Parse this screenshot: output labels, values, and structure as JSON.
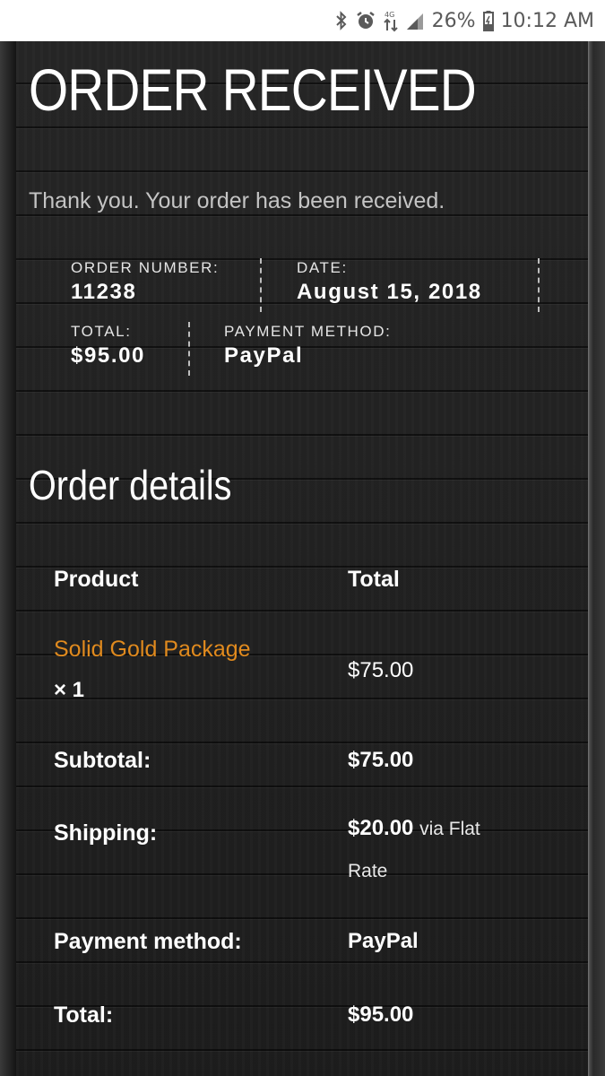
{
  "status_bar": {
    "battery_percent": "26%",
    "time": "10:12 AM",
    "icons": [
      "bluetooth-icon",
      "alarm-icon",
      "data-arrows-icon",
      "signal-icon",
      "battery-icon"
    ]
  },
  "page": {
    "title": "ORDER RECEIVED",
    "thank_you": "Thank you. Your order has been received."
  },
  "overview": {
    "order_number_label": "ORDER NUMBER:",
    "order_number": "11238",
    "date_label": "DATE:",
    "date": "August 15, 2018",
    "total_label": "TOTAL:",
    "total": "$95.00",
    "payment_label": "PAYMENT METHOD:",
    "payment": "PayPal"
  },
  "order_details": {
    "heading": "Order details",
    "col_product": "Product",
    "col_total": "Total",
    "item": {
      "name": "Solid Gold Package",
      "quantity": "× 1",
      "total": "$75.00"
    },
    "subtotal_label": "Subtotal:",
    "subtotal": "$75.00",
    "shipping_label": "Shipping:",
    "shipping_amount": "$20.00",
    "shipping_via": "via Flat",
    "shipping_rate": "Rate",
    "payment_method_label": "Payment method:",
    "payment_method": "PayPal",
    "total_label": "Total:",
    "total": "$95.00"
  },
  "colors": {
    "link": "#e08a1e",
    "text": "#ffffff",
    "muted": "#c4c4c4",
    "background": "#232323"
  }
}
